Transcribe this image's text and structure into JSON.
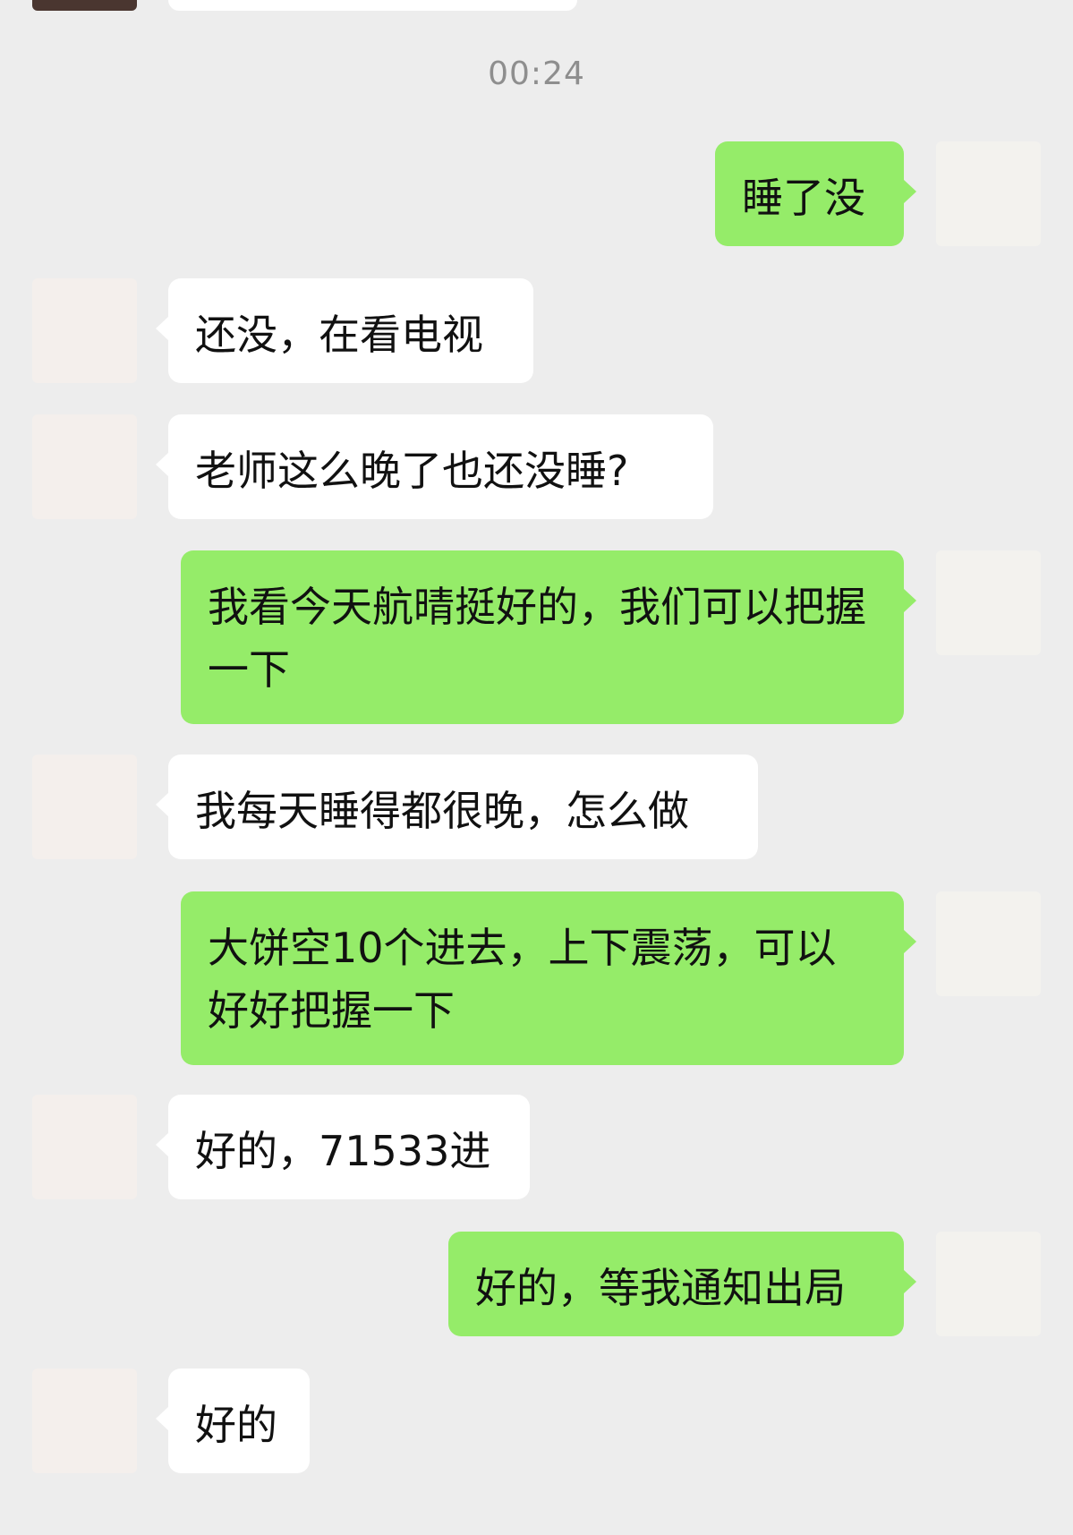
{
  "timestamp": "00:24",
  "messages": [
    {
      "side": "right",
      "text": "睡了没"
    },
    {
      "side": "left",
      "text": "还没，在看电视"
    },
    {
      "side": "left",
      "text": "老师这么晚了也还没睡?"
    },
    {
      "side": "right",
      "text": "我看今天航晴挺好的，我们可以把握一下"
    },
    {
      "side": "left",
      "text": "我每天睡得都很晚，怎么做"
    },
    {
      "side": "right",
      "text": "大饼空10个进去，上下震荡，可以好好把握一下"
    },
    {
      "side": "left",
      "text": "好的，71533进"
    },
    {
      "side": "right",
      "text": "好的，等我通知出局"
    },
    {
      "side": "left",
      "text": "好的"
    }
  ],
  "colors": {
    "background": "#ededed",
    "sent_bubble": "#95ec69",
    "received_bubble": "#ffffff",
    "timestamp_text": "#8e8e8e"
  },
  "icons": {
    "self_avatar": "doraemon-avatar-icon",
    "contact_avatar": "pixelated-avatar-icon"
  }
}
